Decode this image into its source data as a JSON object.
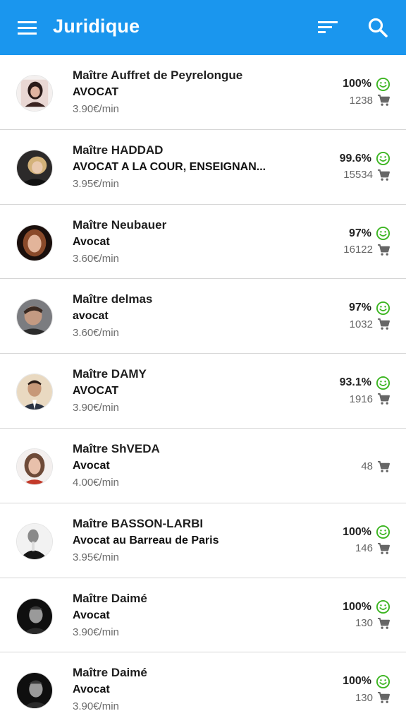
{
  "appbar": {
    "title": "Juridique",
    "color": "#1a96ee",
    "menu_icon": "menu-icon",
    "sort_icon": "sort-icon",
    "search_icon": "search-icon"
  },
  "lawyers": [
    {
      "name": "Maître Auffret de Peyrelongue",
      "role": "AVOCAT",
      "price": "3.90€/min",
      "rating": "100%",
      "count": "1238",
      "avatar": "woman-dark-hair"
    },
    {
      "name": "Maître HADDAD",
      "role": "AVOCAT A LA COUR, ENSEIGNAN...",
      "price": "3.95€/min",
      "rating": "99.6%",
      "count": "15534",
      "avatar": "woman-blonde"
    },
    {
      "name": "Maître Neubauer",
      "role": "Avocat",
      "price": "3.60€/min",
      "rating": "97%",
      "count": "16122",
      "avatar": "woman-auburn"
    },
    {
      "name": "Maître delmas",
      "role": "avocat",
      "price": "3.60€/min",
      "rating": "97%",
      "count": "1032",
      "avatar": "man-dark"
    },
    {
      "name": "Maître DAMY",
      "role": "AVOCAT",
      "price": "3.90€/min",
      "rating": "93.1%",
      "count": "1916",
      "avatar": "man-suit"
    },
    {
      "name": "Maître ShVEDA",
      "role": "Avocat",
      "price": "4.00€/min",
      "rating": "",
      "count": "48",
      "avatar": "woman-brown-hair"
    },
    {
      "name": "Maître BASSON-LARBI",
      "role": "Avocat au Barreau de Paris",
      "price": "3.95€/min",
      "rating": "100%",
      "count": "146",
      "avatar": "man-bw"
    },
    {
      "name": "Maître Daimé",
      "role": "Avocat",
      "price": "3.90€/min",
      "rating": "100%",
      "count": "130",
      "avatar": "man-bw-2"
    },
    {
      "name": "Maître Daimé",
      "role": "Avocat",
      "price": "3.90€/min",
      "rating": "100%",
      "count": "130",
      "avatar": "man-bw-2"
    }
  ],
  "colors": {
    "rating_icon": "#3cb521",
    "cart_icon": "#666666"
  }
}
